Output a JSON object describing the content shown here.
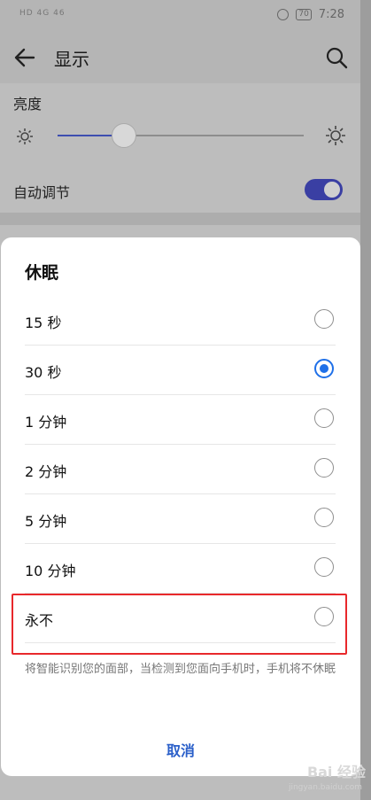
{
  "status_bar": {
    "left": "HD 4G 46",
    "battery": "70",
    "time": "7:28"
  },
  "app_bar": {
    "title": "显示"
  },
  "brightness": {
    "label": "亮度",
    "level_fraction": 0.27
  },
  "auto_adjust": {
    "label": "自动调节",
    "enabled": true
  },
  "dialog": {
    "title": "休眠",
    "options": [
      {
        "label": "15 秒",
        "checked": false
      },
      {
        "label": "30 秒",
        "checked": true
      },
      {
        "label": "1 分钟",
        "checked": false
      },
      {
        "label": "2 分钟",
        "checked": false
      },
      {
        "label": "5 分钟",
        "checked": false
      },
      {
        "label": "10 分钟",
        "checked": false
      },
      {
        "label": "永不",
        "checked": false
      }
    ],
    "note": "将智能识别您的面部，当检测到您面向手机时，手机将不休眠",
    "cancel": "取消"
  },
  "watermark": {
    "brand": "Bai 经验",
    "url": "jingyan.baidu.com"
  },
  "colors": {
    "accent": "#1f70e8",
    "highlight": "#e8282b",
    "toggle": "#3a3fa3"
  }
}
